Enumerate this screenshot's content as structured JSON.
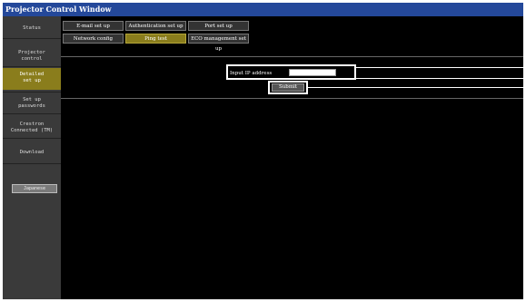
{
  "window": {
    "title": "Projector Control Window"
  },
  "sidebar": {
    "items": [
      {
        "label": "Status",
        "active": false
      },
      {
        "label": "Projector\ncontrol",
        "active": false
      },
      {
        "label": "Detailed\nset up",
        "active": true
      },
      {
        "label": "Set up\npasswords",
        "active": false
      },
      {
        "label": "Crestron\nConnected (TM)",
        "active": false
      },
      {
        "label": "Download",
        "active": false
      }
    ],
    "language_button": "Japanese"
  },
  "tabs": {
    "row1": [
      "E-mail set up",
      "Authentication set up",
      "Port set up"
    ],
    "row2": [
      "Network config",
      "Ping test",
      "ECO management set up"
    ],
    "active": "Ping test"
  },
  "ping_test": {
    "ip_label": "Input IP address",
    "ip_value": "",
    "submit_label": "Submit"
  }
}
